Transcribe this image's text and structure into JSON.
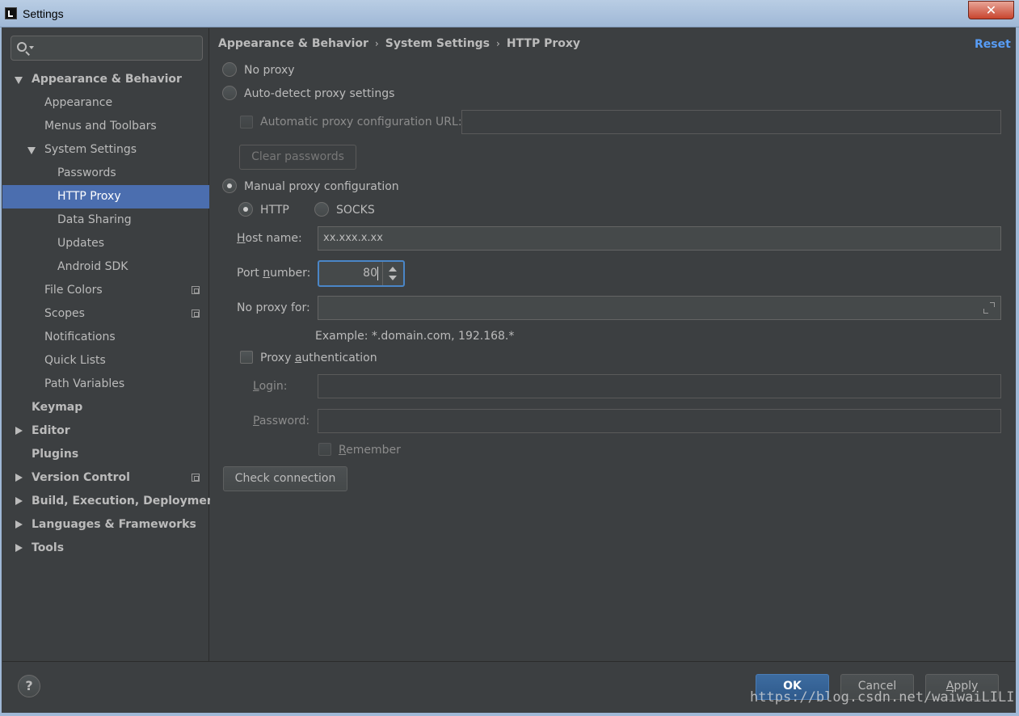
{
  "window": {
    "title": "Settings",
    "close_glyph": "✕"
  },
  "sidebar": {
    "search": {
      "placeholder": "",
      "icon": "search-icon"
    },
    "items": [
      {
        "label": "Appearance & Behavior",
        "bold": true,
        "expanded": true
      },
      {
        "label": "Appearance"
      },
      {
        "label": "Menus and Toolbars"
      },
      {
        "label": "System Settings",
        "expanded": true
      },
      {
        "label": "Passwords"
      },
      {
        "label": "HTTP Proxy",
        "selected": true
      },
      {
        "label": "Data Sharing"
      },
      {
        "label": "Updates"
      },
      {
        "label": "Android SDK"
      },
      {
        "label": "File Colors",
        "project_icon": true
      },
      {
        "label": "Scopes",
        "project_icon": true
      },
      {
        "label": "Notifications"
      },
      {
        "label": "Quick Lists"
      },
      {
        "label": "Path Variables"
      },
      {
        "label": "Keymap",
        "bold": true
      },
      {
        "label": "Editor",
        "bold": true,
        "collapsed": true
      },
      {
        "label": "Plugins",
        "bold": true
      },
      {
        "label": "Version Control",
        "bold": true,
        "collapsed": true,
        "project_icon": true
      },
      {
        "label": "Build, Execution, Deployment",
        "bold": true,
        "collapsed": true
      },
      {
        "label": "Languages & Frameworks",
        "bold": true,
        "collapsed": true
      },
      {
        "label": "Tools",
        "bold": true,
        "collapsed": true
      }
    ]
  },
  "header": {
    "breadcrumb": [
      "Appearance & Behavior",
      "System Settings",
      "HTTP Proxy"
    ],
    "separator": "›",
    "reset_label": "Reset"
  },
  "proxy": {
    "no_proxy_label": "No proxy",
    "auto_detect_label": "Auto-detect proxy settings",
    "auto_config_url_label": "Automatic proxy configuration URL:",
    "auto_config_url_value": "",
    "clear_passwords_label": "Clear passwords",
    "manual_label": "Manual proxy configuration",
    "selected_mode": "manual",
    "http_label": "HTTP",
    "socks_label": "SOCKS",
    "selected_type": "HTTP",
    "host_label_mnemonic": "H",
    "host_label_rest": "ost name:",
    "host_value": "xx.xxx.x.xx",
    "port_label_pre": "Port ",
    "port_label_mnemonic": "n",
    "port_label_rest": "umber:",
    "port_value": "80",
    "no_proxy_for_label": "No proxy for:",
    "no_proxy_for_value": "",
    "example_text": "Example: *.domain.com, 192.168.*",
    "auth_label_pre": "Proxy ",
    "auth_label_mnemonic": "a",
    "auth_label_rest": "uthentication",
    "auth_checked": false,
    "login_label_mnemonic": "L",
    "login_label_rest": "ogin:",
    "login_value": "",
    "password_label_mnemonic": "P",
    "password_label_rest": "assword:",
    "password_value": "",
    "remember_label_mnemonic": "R",
    "remember_label_rest": "emember",
    "check_connection_label": "Check connection"
  },
  "footer": {
    "help_label": "?",
    "ok_label": "OK",
    "cancel_label": "Cancel",
    "apply_label_mnemonic": "A",
    "apply_label_rest": "pply"
  },
  "watermark": "https://blog.csdn.net/waiwaiLILI",
  "colors": {
    "background": "#3c3f41",
    "selection": "#4b6eaf",
    "link": "#589df6",
    "focus": "#4a86c7",
    "primary_button": "#365f91"
  }
}
